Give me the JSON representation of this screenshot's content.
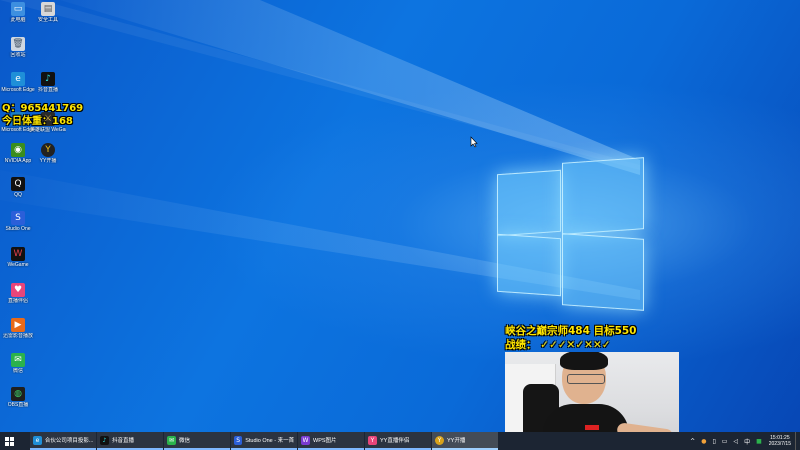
{
  "desktop_icons": [
    {
      "name": "此电脑",
      "icon": "computer-icon",
      "color": "#3d8fe0",
      "glyph": "▭"
    },
    {
      "name": "安全工具",
      "icon": "tool-icon",
      "color": "#d8d8d8",
      "glyph": "▤"
    },
    {
      "name": "回收站",
      "icon": "recycle-bin-icon",
      "color": "#cfd8e2",
      "glyph": "🗑"
    },
    {
      "name": "Microsoft Edge",
      "icon": "edge-icon",
      "color": "#1f8fd8",
      "glyph": "e"
    },
    {
      "name": "抖音直播",
      "icon": "douyin-icon",
      "color": "#111111",
      "glyph": "♪"
    },
    {
      "name": "Microsoft Edge",
      "icon": "edge-icon-2",
      "color": "#1a7fc8",
      "glyph": "e"
    },
    {
      "name": "英雄联盟 WeGame版",
      "icon": "lol-icon",
      "color": "#2a2a2a",
      "glyph": "⚔"
    },
    {
      "name": "NVIDIA App",
      "icon": "nvidia-icon",
      "color": "#3a8d1e",
      "glyph": "◉"
    },
    {
      "name": "YY开播",
      "icon": "yy-icon",
      "color": "#222222",
      "glyph": "Y"
    },
    {
      "name": "QQ",
      "icon": "qq-icon",
      "color": "#111111",
      "glyph": "Q"
    },
    {
      "name": "Studio One",
      "icon": "studio-one-icon",
      "color": "#2b5fd9",
      "glyph": "S"
    },
    {
      "name": "WeGame",
      "icon": "wegame-icon",
      "color": "#111111",
      "glyph": "W"
    },
    {
      "name": "直播伴侣",
      "icon": "live-companion-icon",
      "color": "#e8457a",
      "glyph": "♥"
    },
    {
      "name": "迅雷影音播放",
      "icon": "xunlei-icon",
      "color": "#e86a1a",
      "glyph": "▶"
    },
    {
      "name": "微信",
      "icon": "wechat-icon",
      "color": "#2bb24c",
      "glyph": "✉"
    },
    {
      "name": "OBS直播",
      "icon": "obs-icon",
      "color": "#1f1f1f",
      "glyph": "◍"
    }
  ],
  "overlay": {
    "qq": "Q：965441769",
    "weight": "今日体重：168",
    "rank": "峡谷之巅宗师484 目标550",
    "record": "战绩：  ✓✓✓✕✓✕✕✓"
  },
  "taskbar": {
    "items": [
      {
        "label": "合伙公司项目投影...",
        "icon": "edge-task-icon",
        "color": "#1f8fd8",
        "glyph": "e"
      },
      {
        "label": "抖音直播",
        "icon": "douyin-task-icon",
        "color": "#111111",
        "glyph": "♪"
      },
      {
        "label": "微信",
        "icon": "wechat-task-icon",
        "color": "#2bb24c",
        "glyph": "✉"
      },
      {
        "label": "Studio One - 来一首...",
        "icon": "studio-one-task-icon",
        "color": "#2b5fd9",
        "glyph": "S"
      },
      {
        "label": "WPS图片",
        "icon": "wps-image-task-icon",
        "color": "#7a3ad1",
        "glyph": "W"
      },
      {
        "label": "YY直播伴侣",
        "icon": "yy-live-task-icon",
        "color": "#e8457a",
        "glyph": "Y"
      },
      {
        "label": "YY开播",
        "icon": "yy-task-icon",
        "color": "#d8a21a",
        "glyph": "Y"
      }
    ],
    "tray": {
      "chevron": "^",
      "lang": "中",
      "time": "15:01:25",
      "date": "2023/7/15"
    }
  }
}
